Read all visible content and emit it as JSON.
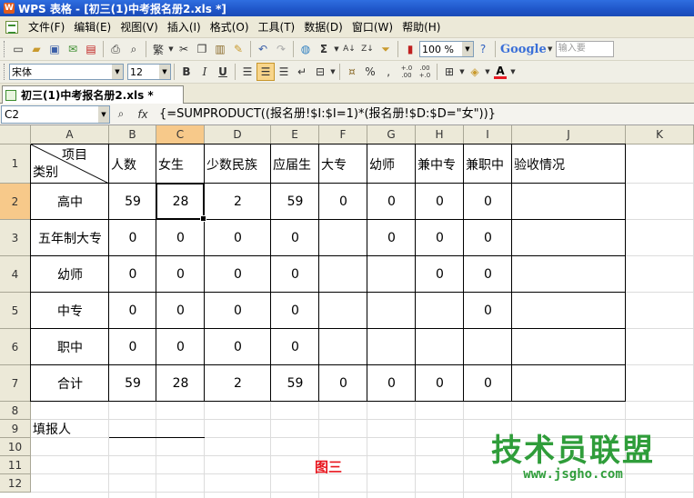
{
  "window": {
    "title": "WPS 表格 - [初三(1)中考报名册2.xls *]",
    "app_icon": "wps-logo-icon"
  },
  "menu": [
    "文件(F)",
    "编辑(E)",
    "视图(V)",
    "插入(I)",
    "格式(O)",
    "工具(T)",
    "数据(D)",
    "窗口(W)",
    "帮助(H)"
  ],
  "toolbar1": {
    "zoom": "100 %",
    "sum_symbol": "Σ",
    "traditional_char": "繁",
    "search_brand": "Google",
    "search_placeholder": "输入要"
  },
  "toolbar2": {
    "font_name": "宋体",
    "font_size": "12",
    "bold": "B",
    "italic": "I",
    "underline": "U",
    "percent": "%",
    "comma": "‚",
    "inc_decimal": "+.0 .00",
    "dec_decimal": ".00 +.0",
    "font_color_letter": "A"
  },
  "doc_tab": "初三(1)中考报名册2.xls *",
  "formula_bar": {
    "cell_ref": "C2",
    "fx_label": "fx",
    "formula": "{=SUMPRODUCT((报名册!$I:$I=1)*(报名册!$D:$D=\"女\"))}"
  },
  "grid": {
    "columns": [
      "A",
      "B",
      "C",
      "D",
      "E",
      "F",
      "G",
      "H",
      "I",
      "J",
      "K"
    ],
    "rows": [
      "1",
      "2",
      "3",
      "4",
      "5",
      "6",
      "7",
      "8",
      "9",
      "10",
      "11",
      "12"
    ],
    "active_cell": "C2",
    "header_corner": {
      "top": "项目",
      "bottom": "类别"
    },
    "header_row": [
      "人数",
      "女生",
      "少数民族",
      "应届生",
      "大专",
      "幼师",
      "兼中专",
      "兼职中",
      "验收情况"
    ],
    "data_rows": [
      {
        "label": "高中",
        "values": [
          "59",
          "28",
          "2",
          "59",
          "0",
          "0",
          "0",
          "0"
        ]
      },
      {
        "label": "五年制大专",
        "values": [
          "0",
          "0",
          "0",
          "0",
          "",
          "0",
          "0",
          "0"
        ]
      },
      {
        "label": "幼师",
        "values": [
          "0",
          "0",
          "0",
          "0",
          "",
          "",
          "0",
          "0"
        ]
      },
      {
        "label": "中专",
        "values": [
          "0",
          "0",
          "0",
          "0",
          "",
          "",
          "",
          "0"
        ]
      },
      {
        "label": "职中",
        "values": [
          "0",
          "0",
          "0",
          "0",
          "",
          "",
          "",
          ""
        ]
      },
      {
        "label": "合计",
        "values": [
          "59",
          "28",
          "2",
          "59",
          "0",
          "0",
          "0",
          "0"
        ]
      }
    ],
    "filler_label": "填报人",
    "caption": "图三"
  },
  "watermark": {
    "title": "技术员联盟",
    "url": "www.jsgho.com"
  }
}
